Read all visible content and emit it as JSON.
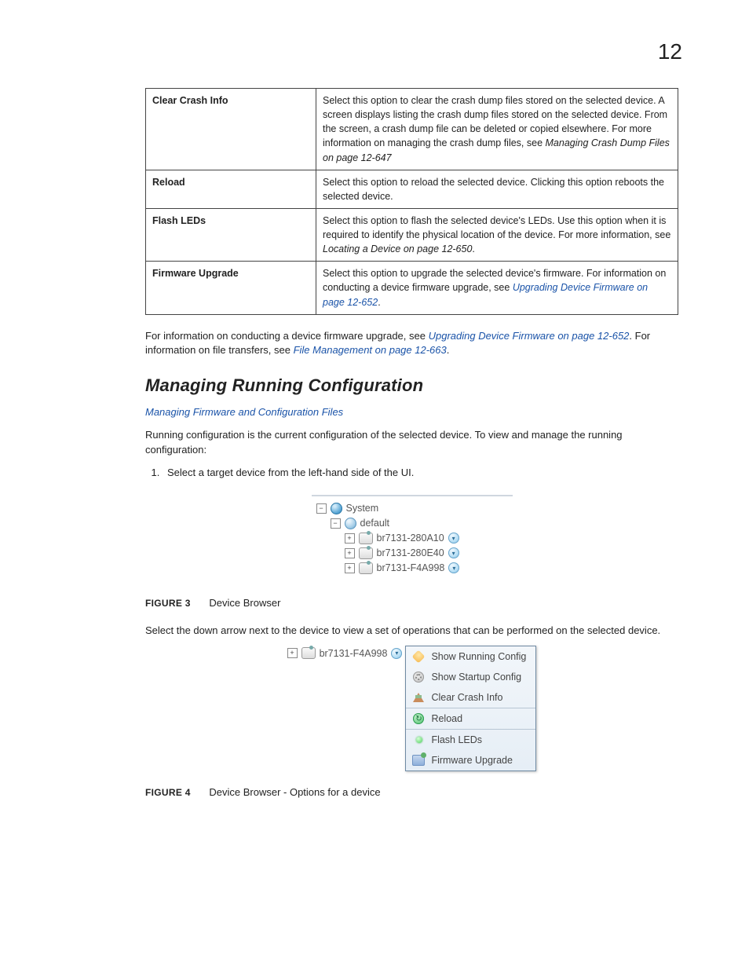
{
  "page_number": "12",
  "table_rows": [
    {
      "label": "Clear Crash Info",
      "desc_pre": "Select this option to clear the crash dump files stored on the selected device. A screen displays listing the crash dump files stored on the selected device. From the screen, a crash dump file can be deleted or copied elsewhere. For more information on managing the crash dump files, see ",
      "italic_ref": "Managing Crash Dump Files on page 12-647",
      "desc_post": ""
    },
    {
      "label": "Reload",
      "desc_pre": "Select this option to reload the selected device. Clicking this option reboots the selected device.",
      "italic_ref": "",
      "desc_post": ""
    },
    {
      "label": "Flash LEDs",
      "desc_pre": "Select this option to flash the selected device's LEDs. Use this option when it is required to identify the physical location of the device. For more information, see ",
      "italic_ref": "Locating a Device on page 12-650",
      "desc_post": "."
    },
    {
      "label": "Firmware Upgrade",
      "desc_pre": "Select this option to upgrade the selected device's firmware. For information on conducting a device firmware upgrade, see ",
      "link_ref": "Upgrading Device Firmware on page 12-652",
      "desc_post": "."
    }
  ],
  "intro_para": {
    "pre1": "For information on conducting a device firmware upgrade, see ",
    "link1": "Upgrading Device Firmware on page 12-652",
    "mid": ". For information on file transfers, see ",
    "link2": "File Management on page 12-663",
    "post": "."
  },
  "section_heading": "Managing Running Configuration",
  "sub_link": "Managing Firmware and Configuration Files",
  "running_config_desc": "Running configuration is the current configuration of the selected device. To view and manage the running configuration:",
  "step1": "Select a target device from the left-hand side of the UI.",
  "tree": {
    "root": "System",
    "group": "default",
    "devices": [
      "br7131-280A10",
      "br7131-280E40",
      "br7131-F4A998"
    ]
  },
  "figure3": {
    "label": "FIGURE 3",
    "caption": "Device Browser"
  },
  "select_arrow_para": "Select the down arrow next to the device to view a set of operations that can be performed on the selected device.",
  "fig2_device": "br7131-F4A998",
  "ctx_menu": [
    "Show Running Config",
    "Show Startup Config",
    "Clear Crash Info",
    "Reload",
    "Flash LEDs",
    "Firmware Upgrade"
  ],
  "figure4": {
    "label": "FIGURE 4",
    "caption": "Device Browser - Options for a device"
  }
}
